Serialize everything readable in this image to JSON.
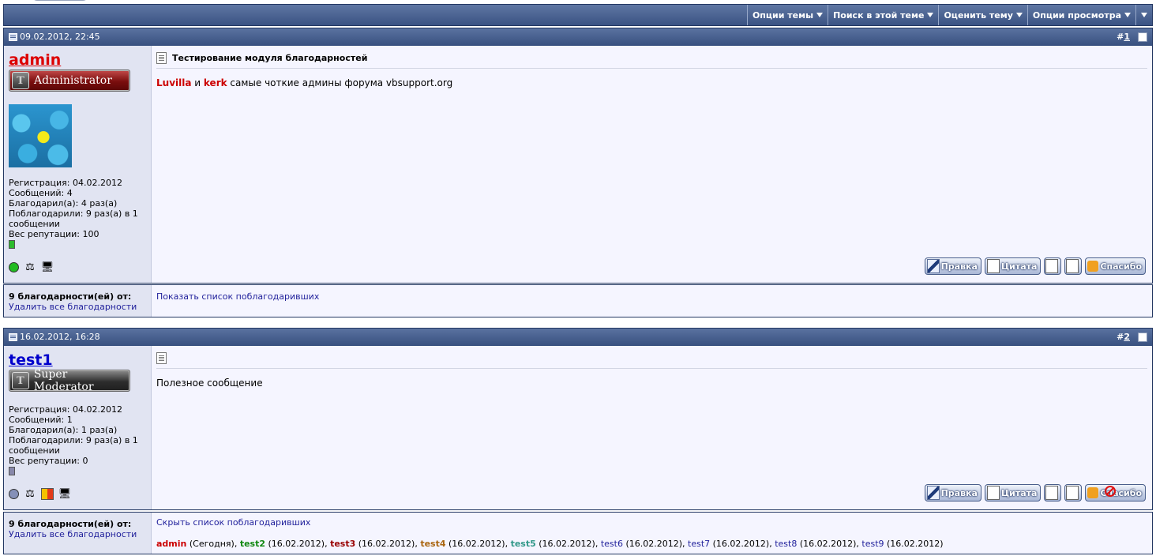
{
  "toolbar": {
    "menus": [
      "Опции темы",
      "Поиск в этой теме",
      "Оценить тему",
      "Опции просмотра"
    ]
  },
  "posts": [
    {
      "date": "09.02.2012, 22:45",
      "number_prefix": "#",
      "number": "1",
      "username": "admin",
      "username_color": "#dd0000",
      "rank": "Administrator",
      "rank_emblem": "T",
      "stats": {
        "registration": "Регистрация: 04.02.2012",
        "messages": "Сообщений: 4",
        "thanked": "Благодарил(а): 4 раз(а)",
        "was_thanked": "Поблагодарили: 9 раз(а) в 1 сообщении",
        "reputation": "Вес репутации: 100"
      },
      "reputation_color": "#2dbb2d",
      "status_color": "#22bb22",
      "title": "Тестирование модуля благодарностей",
      "message_parts": [
        "Luvilla",
        " и ",
        "kerk",
        " самые чоткие админы форума vbsupport.org"
      ]
    },
    {
      "date": "16.02.2012, 16:28",
      "number_prefix": "#",
      "number": "2",
      "username": "test1",
      "username_color": "#0000cc",
      "rank": "Super Moderator",
      "rank_emblem": "T",
      "stats": {
        "registration": "Регистрация: 04.02.2012",
        "messages": "Сообщений: 1",
        "thanked": "Благодарил(а): 1 раз(а)",
        "was_thanked": "Поблагодарили: 9 раз(а) в 1 сообщении",
        "reputation": "Вес репутации: 0"
      },
      "reputation_color": "#8888aa",
      "status_color": "#8590b8",
      "title": "",
      "message": "Полезное сообщение"
    }
  ],
  "buttons": {
    "edit": "Правка",
    "quote": "Цитата",
    "thanks": "Спасибо"
  },
  "thanks_blocks": [
    {
      "title": "9 благодарности(ей) от:",
      "remove_all": "Удалить все благодарности",
      "toggle": "Показать список поблагодаривших"
    },
    {
      "title": "9 благодарности(ей) от:",
      "remove_all": "Удалить все благодарности",
      "toggle": "Скрыть список поблагодаривших",
      "list": [
        {
          "name": "admin",
          "date": " (Сегодня)",
          "color": "#cc0000",
          "bold": true
        },
        {
          "name": "test2",
          "date": " (16.02.2012)",
          "color": "#118811",
          "bold": true
        },
        {
          "name": "test3",
          "date": " (16.02.2012)",
          "color": "#990000",
          "bold": true
        },
        {
          "name": "test4",
          "date": " (16.02.2012)",
          "color": "#aa6611",
          "bold": true
        },
        {
          "name": "test5",
          "date": " (16.02.2012)",
          "color": "#33998a",
          "bold": true
        },
        {
          "name": "test6",
          "date": " (16.02.2012)",
          "color": "#22229c",
          "bold": false
        },
        {
          "name": "test7",
          "date": " (16.02.2012)",
          "color": "#22229c",
          "bold": false
        },
        {
          "name": "test8",
          "date": " (16.02.2012)",
          "color": "#22229c",
          "bold": false
        },
        {
          "name": "test9",
          "date": " (16.02.2012)",
          "color": "#22229c",
          "bold": false
        }
      ]
    }
  ]
}
